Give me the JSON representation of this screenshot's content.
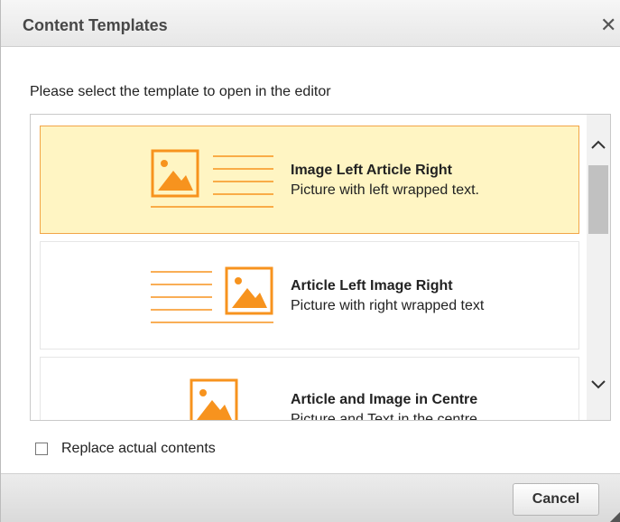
{
  "dialog": {
    "title": "Content Templates",
    "close_symbol": "✕",
    "instruction": "Please select the template to open in the editor",
    "templates": [
      {
        "title": "Image Left Article Right",
        "description": "Picture with left wrapped text.",
        "selected": true
      },
      {
        "title": "Article Left Image Right",
        "description": "Picture with right wrapped text",
        "selected": false
      },
      {
        "title": "Article and Image in Centre",
        "description": "Picture and Text in the centre",
        "selected": false
      }
    ],
    "replace_label": "Replace actual contents",
    "replace_checked": false,
    "cancel_label": "Cancel"
  },
  "colors": {
    "accent": "#f7931e",
    "selected_background": "#fff5c3",
    "selected_border": "#f2a547"
  },
  "icons": [
    "close-icon",
    "image-icon",
    "text-lines-icon",
    "chevron-up-icon",
    "chevron-down-icon",
    "resize-grip-icon"
  ]
}
